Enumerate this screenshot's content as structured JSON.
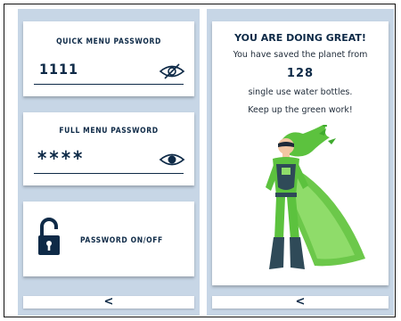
{
  "left_panel": {
    "quick_menu": {
      "title": "QUICK MENU PASSWORD",
      "value": "1111",
      "icon": "eye-off-icon"
    },
    "full_menu": {
      "title": "FULL MENU PASSWORD",
      "value": "****",
      "icon": "eye-icon"
    },
    "toggle": {
      "label": "PASSWORD ON/OFF",
      "icon": "unlocked-padlock-icon"
    },
    "back_label": "<"
  },
  "right_panel": {
    "headline": "YOU ARE DOING GREAT!",
    "line1": "You have saved the planet from",
    "count": "128",
    "line2": "single use water bottles.",
    "line3": "Keep up the green work!",
    "image": "superhero-illustration",
    "back_label": "<"
  },
  "colors": {
    "navy": "#0e2a47",
    "panel": "#c7d6e6",
    "green": "#5cc23e"
  }
}
